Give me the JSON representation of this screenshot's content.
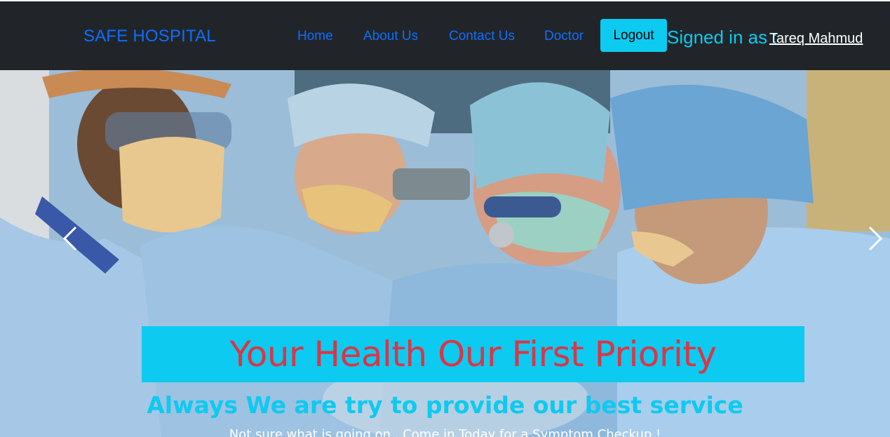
{
  "navbar": {
    "brand": "SAFE HOSPITAL",
    "links": [
      {
        "label": "Home"
      },
      {
        "label": "About Us"
      },
      {
        "label": "Contact Us"
      },
      {
        "label": "Doctor"
      }
    ],
    "logout_label": "Logout",
    "signed_in_label": "Signed in as :",
    "user_name": "Tareq Mahmud"
  },
  "hero": {
    "image_icon": "surgeons-photo",
    "title": "Your Health Our First Priority",
    "subtitle": "Always We are try to provide our best service",
    "text": "Not sure what is going on , Come in Today for a Symptom Checkup !",
    "prev_icon": "chevron-left-icon",
    "next_icon": "chevron-right-icon"
  },
  "colors": {
    "navbar_bg": "#212529",
    "link": "#0d6efd",
    "accent": "#0dcaf0",
    "title_red": "#dc3545"
  }
}
